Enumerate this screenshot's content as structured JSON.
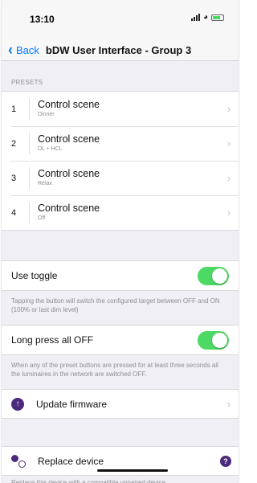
{
  "status_bar": {
    "time": "13:10"
  },
  "nav": {
    "back_label": "Back",
    "title": "bDW User Interface - Group 3"
  },
  "presets": {
    "header": "PRESETS",
    "items": [
      {
        "number": "1",
        "title": "Control scene",
        "subtitle": "Dinner"
      },
      {
        "number": "2",
        "title": "Control scene",
        "subtitle": "DL + HCL"
      },
      {
        "number": "3",
        "title": "Control scene",
        "subtitle": "Relax"
      },
      {
        "number": "4",
        "title": "Control scene",
        "subtitle": "Off"
      }
    ]
  },
  "use_toggle": {
    "label": "Use toggle",
    "on": true,
    "note": "Tapping the button will switch the configured target between OFF and ON (100% or last dim level)"
  },
  "long_press": {
    "label": "Long press all OFF",
    "on": true,
    "note": "When any of the preset buttons are pressed for at least three seconds all the luminaires in the network are switched OFF."
  },
  "update_firmware": {
    "label": "Update firmware",
    "icon": "arrow-up-circle-icon"
  },
  "replace_device": {
    "label": "Replace device",
    "icon": "replace-device-icon",
    "note": "Replace this device with a compatible unpaired device"
  },
  "colors": {
    "accent": "#007aff",
    "toggle_on": "#4cd964",
    "brand": "#4b2a7e"
  }
}
